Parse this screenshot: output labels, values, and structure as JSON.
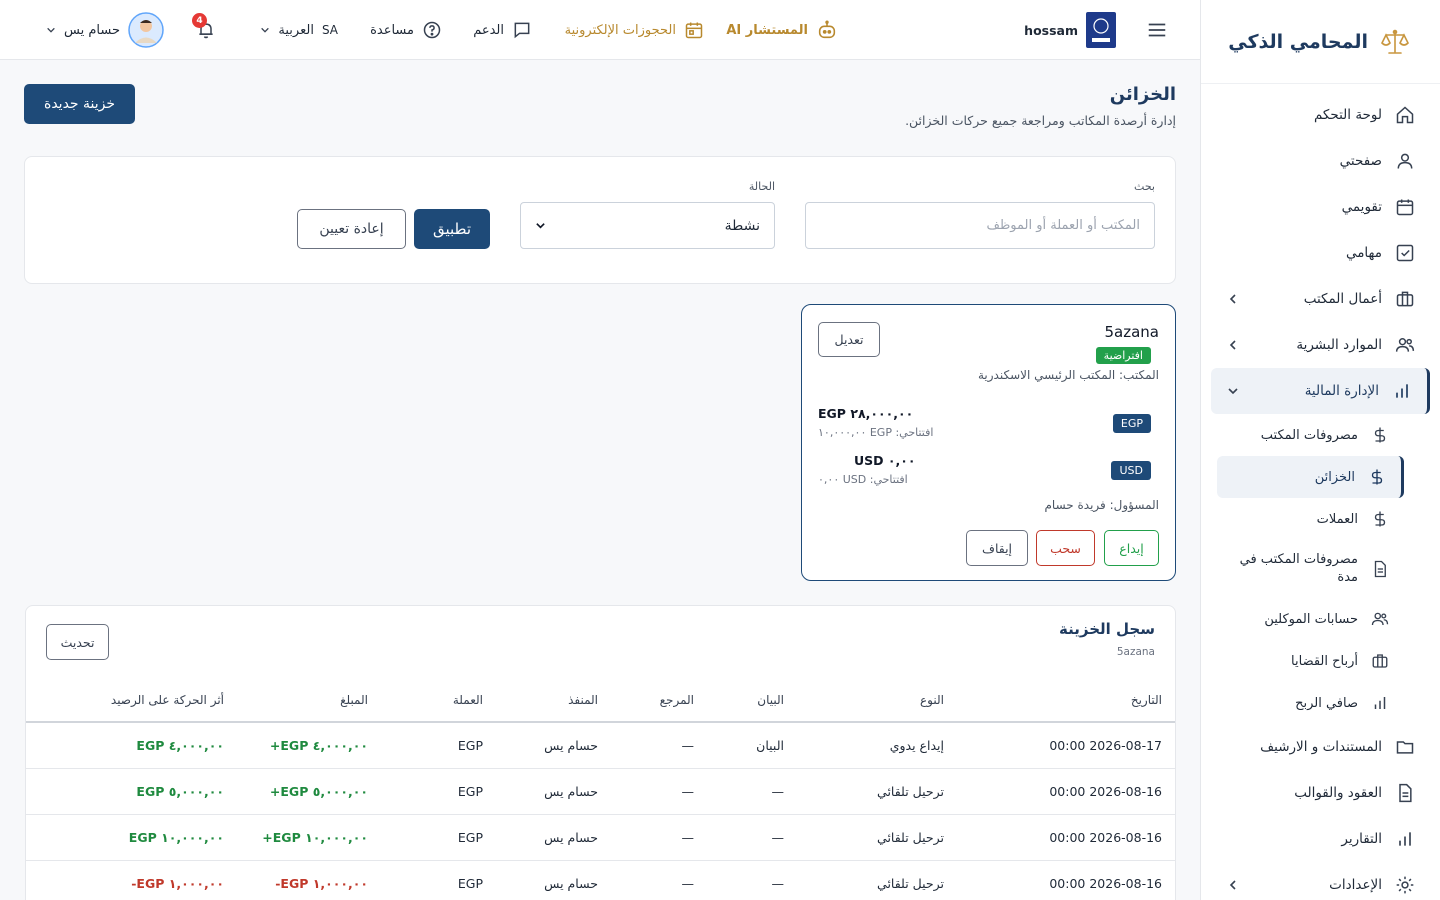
{
  "brand": {
    "title": "المحامي الذكي"
  },
  "sidebar": {
    "items": [
      {
        "label": "لوحة التحكم",
        "icon": "home-icon"
      },
      {
        "label": "صفحتي",
        "icon": "user-icon"
      },
      {
        "label": "تقويمي",
        "icon": "calendar-icon"
      },
      {
        "label": "مهامي",
        "icon": "checkbox-icon"
      },
      {
        "label": "أعمال المكتب",
        "icon": "briefcase-icon"
      },
      {
        "label": "الموارد البشرية",
        "icon": "users-icon"
      },
      {
        "label": "الإدارة المالية",
        "icon": "bar-chart-icon"
      }
    ],
    "finance_sub": [
      {
        "label": "مصروفات المكتب"
      },
      {
        "label": "الخزائن"
      },
      {
        "label": "العملات"
      },
      {
        "label": "مصروفات المكتب في مدة"
      },
      {
        "label": "حسابات الموكلين"
      },
      {
        "label": "أرباح القضايا"
      },
      {
        "label": "صافي الربح"
      }
    ],
    "after": [
      {
        "label": "المستندات و الارشيف"
      },
      {
        "label": "العقود والقوالب"
      },
      {
        "label": "التقارير"
      },
      {
        "label": "الإعدادات"
      }
    ]
  },
  "topbar": {
    "username": "hossam",
    "ai_label": "المستشار AI",
    "bookings_label": "الحجوزات الإلكترونية",
    "support_label": "الدعم",
    "help_label": "مساعدة",
    "lang_code": "SA",
    "lang_label": "العربية",
    "notif_count": "4",
    "profile_name": "حسام يس"
  },
  "page": {
    "title": "الخزائن",
    "subtitle": "إدارة أرصدة المكاتب ومراجعة جميع حركات الخزائن.",
    "new_button": "خزينة جديدة"
  },
  "filters": {
    "search_label": "بحث",
    "search_placeholder": "المكتب أو العملة أو الموظف",
    "status_label": "الحالة",
    "status_value": "نشطة",
    "apply": "تطبيق",
    "reset": "إعادة تعيين"
  },
  "treasury": {
    "name": "5azana",
    "default_badge": "افتراضية",
    "office": "المكتب: المكتب الرئيسي الاسكندرية",
    "edit": "تعديل",
    "balances": [
      {
        "code": "EGP",
        "amount": "EGP ٢٨,٠٠٠,٠٠",
        "opening": "افتتاحي: EGP ١٠,٠٠٠,٠٠"
      },
      {
        "code": "USD",
        "amount": "USD ٠,٠٠",
        "opening": "افتتاحي: USD ٠,٠٠"
      }
    ],
    "responsible": "المسؤول: فريدة حسام",
    "deposit": "إيداع",
    "withdraw": "سحب",
    "stop": "إيقاف"
  },
  "log": {
    "title": "سجل الخزينة",
    "subtitle": "5azana",
    "refresh": "تحديث",
    "headers": [
      "التاريخ",
      "النوع",
      "البيان",
      "المرجع",
      "المنفذ",
      "العملة",
      "المبلغ",
      "أثر الحركة على الرصيد"
    ],
    "rows": [
      {
        "date": "2026-08-17 00:00",
        "type": "إيداع يدوي",
        "desc": "البيان",
        "ref": "—",
        "by": "حسام يس",
        "cur": "EGP",
        "amount": "+EGP ٤,٠٠٠,٠٠",
        "effect": "EGP ٤,٠٠٠,٠٠",
        "sign": "pos"
      },
      {
        "date": "2026-08-16 00:00",
        "type": "ترحيل تلقائي",
        "desc": "—",
        "ref": "—",
        "by": "حسام يس",
        "cur": "EGP",
        "amount": "+EGP ٥,٠٠٠,٠٠",
        "effect": "EGP ٥,٠٠٠,٠٠",
        "sign": "pos"
      },
      {
        "date": "2026-08-16 00:00",
        "type": "ترحيل تلقائي",
        "desc": "—",
        "ref": "—",
        "by": "حسام يس",
        "cur": "EGP",
        "amount": "+EGP ١٠,٠٠٠,٠٠",
        "effect": "EGP ١٠,٠٠٠,٠٠",
        "sign": "pos"
      },
      {
        "date": "2026-08-16 00:00",
        "type": "ترحيل تلقائي",
        "desc": "—",
        "ref": "—",
        "by": "حسام يس",
        "cur": "EGP",
        "amount": "-EGP ١,٠٠٠,٠٠",
        "effect": "-EGP ١,٠٠٠,٠٠",
        "sign": "neg"
      }
    ]
  },
  "colors": {
    "primary": "#1e4a78",
    "gold": "#b8892e",
    "success": "#22a04b",
    "danger": "#c0392b"
  }
}
